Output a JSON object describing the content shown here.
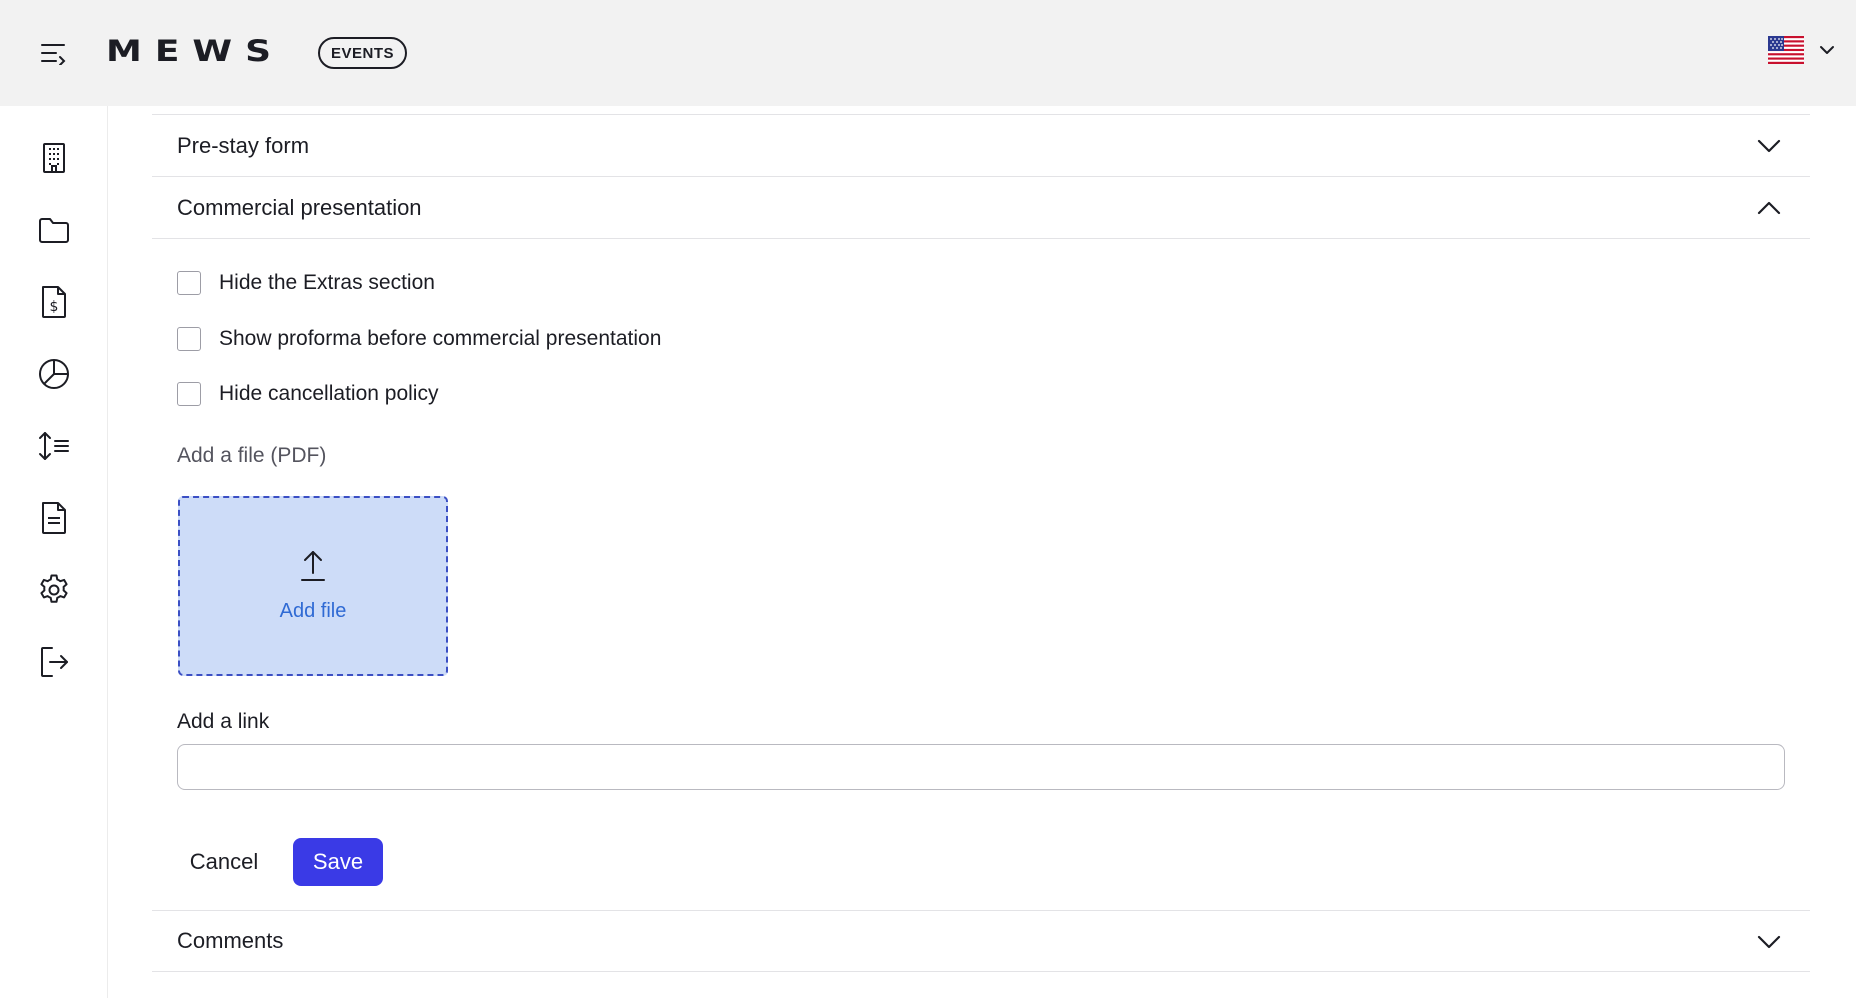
{
  "header": {
    "logo": "MEWS",
    "badge": "EVENTS",
    "menu_icon": "menu-collapse-icon",
    "language_flag": "us-flag-icon"
  },
  "sidebar": {
    "items": [
      {
        "icon": "building-icon"
      },
      {
        "icon": "folder-icon"
      },
      {
        "icon": "invoice-icon"
      },
      {
        "icon": "pie-chart-icon"
      },
      {
        "icon": "sort-list-icon"
      },
      {
        "icon": "document-icon"
      },
      {
        "icon": "gear-icon"
      },
      {
        "icon": "logout-icon"
      }
    ]
  },
  "sections": {
    "pre_stay": {
      "title": "Pre-stay form",
      "expanded": false
    },
    "commercial": {
      "title": "Commercial presentation",
      "expanded": true
    },
    "comments": {
      "title": "Comments",
      "expanded": false
    }
  },
  "commercial_form": {
    "checkboxes": [
      {
        "label": "Hide the Extras section",
        "checked": false
      },
      {
        "label": "Show proforma before commercial presentation",
        "checked": false
      },
      {
        "label": "Hide cancellation policy",
        "checked": false
      }
    ],
    "file_label": "Add a file (PDF)",
    "dropzone_label": "Add file",
    "link_label": "Add a link",
    "link_value": "",
    "cancel_label": "Cancel",
    "save_label": "Save"
  },
  "colors": {
    "accent": "#3a3ae6",
    "dropzone_bg": "#cddcf8",
    "dropzone_border": "#3b4fc4",
    "link_blue": "#2f6ad4",
    "header_bg": "#f2f2f2"
  }
}
